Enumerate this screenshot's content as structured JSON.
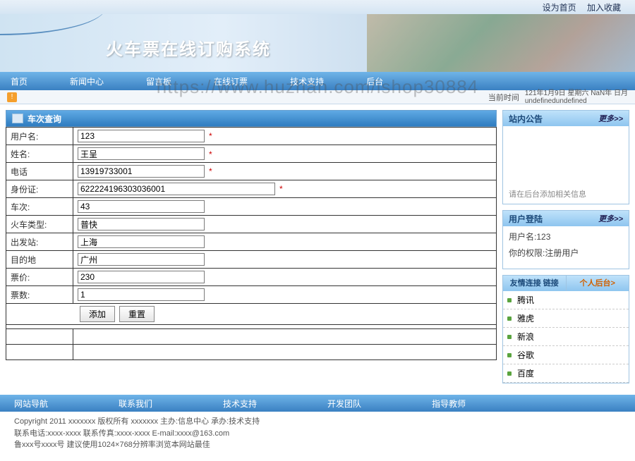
{
  "top_links": {
    "home": "设为首页",
    "fav": "加入收藏"
  },
  "banner": {
    "title": "火车票在线订购系统"
  },
  "watermark": "https://www.huzhan.com/ishop30884",
  "nav": {
    "items": [
      "首页",
      "新闻中心",
      "留言板",
      "在线订票",
      "技术支持",
      "后台"
    ]
  },
  "info_bar": {
    "time_label": "当前时间",
    "time_value_line1": "121年1月9日 星期六 NaN年 日月",
    "time_value_line2": "undefinedundefined"
  },
  "form": {
    "title": "车次查询",
    "rows": [
      {
        "label": "用户名:",
        "value": "123",
        "req": true
      },
      {
        "label": "姓名:",
        "value": "王呈",
        "req": true
      },
      {
        "label": "电话",
        "value": "13919733001",
        "req": true
      },
      {
        "label": "身份证:",
        "value": "622224196303036001",
        "req": true,
        "wide": true
      },
      {
        "label": "车次:",
        "value": "43"
      },
      {
        "label": "火车类型:",
        "value": "普快"
      },
      {
        "label": "出发站:",
        "value": "上海"
      },
      {
        "label": "目的地",
        "value": "广州"
      },
      {
        "label": "票价:",
        "value": "230"
      },
      {
        "label": "票数:",
        "value": "1"
      }
    ],
    "buttons": {
      "add": "添加",
      "reset": "重置"
    }
  },
  "sidebar": {
    "announce": {
      "title": "站内公告",
      "more": "更多>>",
      "placeholder": "请在后台添加相关信息"
    },
    "login": {
      "title": "用户登陆",
      "more": "更多>>",
      "user_label": "用户名:",
      "user_value": "123",
      "role_label": "你的权限:",
      "role_value": "注册用户"
    },
    "links": {
      "tabs": [
        "友情连接 链接",
        "个人后台>"
      ],
      "items": [
        "腾讯",
        "雅虎",
        "新浪",
        "谷歌",
        "百度"
      ]
    }
  },
  "footer": {
    "nav": [
      "网站导航",
      "联系我们",
      "技术支持",
      "开发团队",
      "指导教师"
    ],
    "line1": "Copyright 2011 xxxxxxx 版权所有 xxxxxxx 主办:信息中心 承办:技术支持",
    "line2": "联系电话:xxxx-xxxx 联系传真:xxxx-xxxx E-mail:xxxx@163.com",
    "line3": "鲁xxx号xxxx号   建议使用1024×768分辨率浏览本网站最佳"
  }
}
